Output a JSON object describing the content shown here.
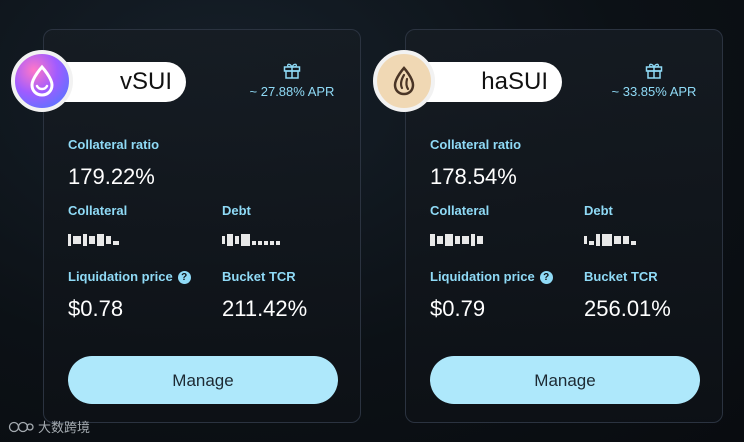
{
  "vaults": [
    {
      "token": "vSUI",
      "apr": "~ 27.88% APR",
      "collateral_ratio_label": "Collateral ratio",
      "collateral_ratio": "179.22%",
      "collateral_label": "Collateral",
      "debt_label": "Debt",
      "liquidation_price_label": "Liquidation price",
      "liquidation_price": "$0.78",
      "bucket_tcr_label": "Bucket TCR",
      "bucket_tcr": "211.42%",
      "manage_label": "Manage"
    },
    {
      "token": "haSUI",
      "apr": "~ 33.85% APR",
      "collateral_ratio_label": "Collateral ratio",
      "collateral_ratio": "178.54%",
      "collateral_label": "Collateral",
      "debt_label": "Debt",
      "liquidation_price_label": "Liquidation price",
      "liquidation_price": "$0.79",
      "bucket_tcr_label": "Bucket TCR",
      "bucket_tcr": "256.01%",
      "manage_label": "Manage"
    }
  ],
  "info_icon_glyph": "?",
  "watermark": "大数跨境",
  "colors": {
    "accent": "#8fdaf6",
    "button": "#aee8fb",
    "card_border": "#2b3340"
  }
}
